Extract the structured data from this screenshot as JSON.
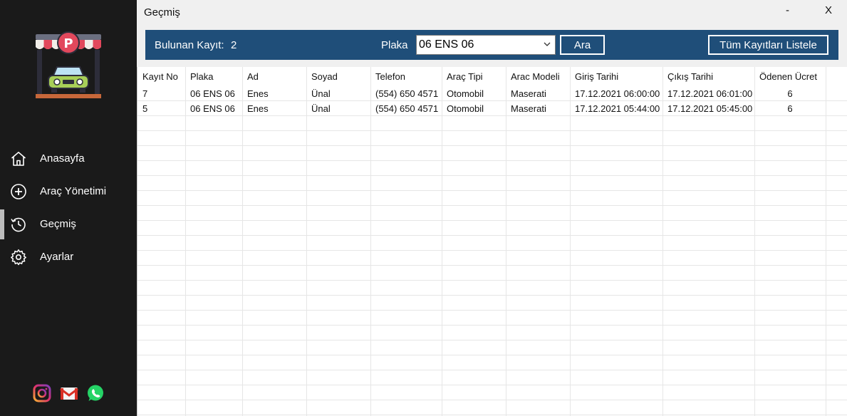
{
  "window": {
    "title": "Geçmiş",
    "minimize": "-",
    "close": "X"
  },
  "sidebar": {
    "items": [
      {
        "label": "Anasayfa",
        "icon": "home-icon"
      },
      {
        "label": "Araç Yönetimi",
        "icon": "plus-circle-icon"
      },
      {
        "label": "Geçmiş",
        "icon": "history-icon",
        "active": true
      },
      {
        "label": "Ayarlar",
        "icon": "gear-icon"
      }
    ],
    "social": [
      "instagram-icon",
      "gmail-icon",
      "whatsapp-icon"
    ]
  },
  "search": {
    "found_label": "Bulunan Kayıt:",
    "found_count": "2",
    "plate_label": "Plaka",
    "plate_value": "06 ENS 06",
    "search_button": "Ara",
    "list_all_button": "Tüm Kayıtları Listele"
  },
  "table": {
    "columns": [
      "Kayıt No",
      "Plaka",
      "Ad",
      "Soyad",
      "Telefon",
      "Araç Tipi",
      "Arac Modeli",
      "Giriş Tarihi",
      "Çıkış Tarihi",
      "Ödenen Ücret"
    ],
    "rows": [
      [
        "7",
        "06 ENS 06",
        "Enes",
        "Ünal",
        "(554) 650 4571",
        "Otomobil",
        "Maserati",
        "17.12.2021 06:00:00",
        "17.12.2021 06:01:00",
        "6"
      ],
      [
        "5",
        "06 ENS 06",
        "Enes",
        "Ünal",
        "(554) 650 4571",
        "Otomobil",
        "Maserati",
        "17.12.2021 05:44:00",
        "17.12.2021 05:45:00",
        "6"
      ]
    ]
  },
  "colors": {
    "sidebar_bg": "#1a1a1a",
    "search_bar_bg": "#1f4e79",
    "grid_bg": "#ffffff"
  }
}
